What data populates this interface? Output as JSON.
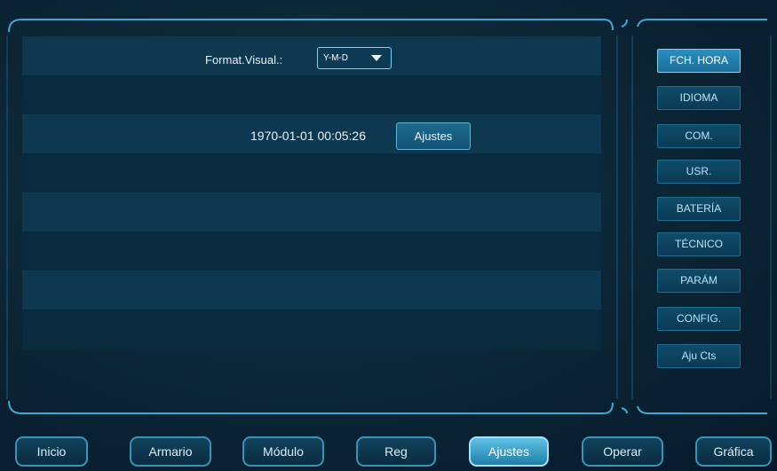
{
  "format": {
    "label": "Format.Visual.:",
    "selected": "Y-M-D"
  },
  "datetime": {
    "value": "1970-01-01 00:05:26",
    "button_label": "Ajustes"
  },
  "side_menu": {
    "items": [
      {
        "label": "FCH. HORA",
        "active": true
      },
      {
        "label": "IDIOMA"
      },
      {
        "label": "COM."
      },
      {
        "label": "USR."
      },
      {
        "label": "BATERÍA"
      },
      {
        "label": "TÉCNICO"
      },
      {
        "label": "PARÁM"
      },
      {
        "label": "CONFIG."
      },
      {
        "label": "Aju Cts"
      }
    ]
  },
  "bottom_nav": {
    "items": [
      {
        "label": "Inicio"
      },
      {
        "label": "Armario"
      },
      {
        "label": "Módulo"
      },
      {
        "label": "Reg"
      },
      {
        "label": "Ajustes",
        "active": true
      },
      {
        "label": "Operar"
      },
      {
        "label": "Gráfica"
      }
    ]
  },
  "colors": {
    "accent": "#2a8ec0",
    "frame_line": "#3fa8d4",
    "row_light": "#0e3850",
    "row_dark": "#0a2a3d"
  }
}
